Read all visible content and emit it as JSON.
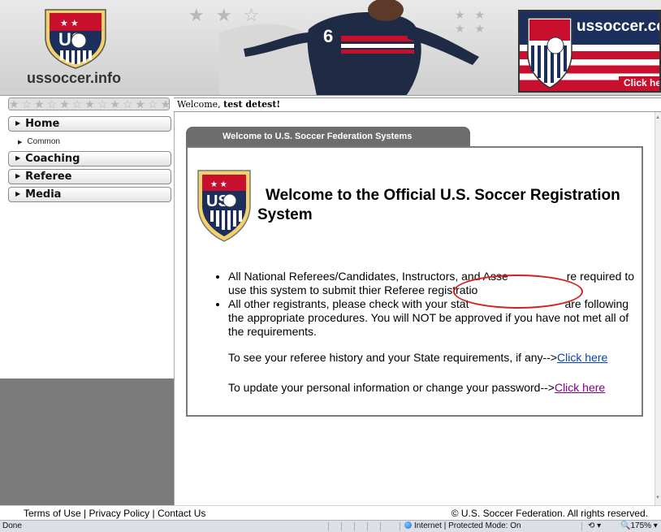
{
  "header": {
    "site_label": "ussoccer.info",
    "crest_text": "US",
    "player_number": "6",
    "ad_text": "ussoccer.co",
    "ad_click": "Click he"
  },
  "welcome": {
    "prefix": "Welcome,",
    "user": "test detest!"
  },
  "sidebar": {
    "items": [
      {
        "label": "Home"
      },
      {
        "label": "Coaching"
      },
      {
        "label": "Referee"
      },
      {
        "label": "Media"
      }
    ],
    "sub_items": [
      {
        "label": "Common"
      }
    ]
  },
  "main": {
    "tab_title": "Welcome to U.S. Soccer Federation Systems",
    "heading": "Welcome to the Official U.S. Soccer Registration System",
    "bullets": [
      {
        "before": "All National Referees/Candidates, Instructors, and Asse",
        "after_gap": "re required to use this system to submit thier Referee registratio"
      },
      {
        "before": "All other registrants, please check with your stat",
        "after_gap": "are following the appropriate procedures.  You will NOT be approved if you have not met all of the requirements."
      }
    ],
    "history_text": "To see your referee history and your State requirements, if any-->",
    "history_link": "Click here",
    "update_text": "To update your personal information or change your password-->",
    "update_link": "Click here"
  },
  "footer": {
    "terms": "Terms of Use",
    "privacy": "Privacy Policy",
    "contact": "Contact Us",
    "separator": "|",
    "copyright": "© U.S. Soccer Federation. All rights reserved."
  },
  "statusbar": {
    "status": "Done",
    "zone": "Internet | Protected Mode: On",
    "zoom": "175%"
  },
  "colors": {
    "navy": "#1c2f5c",
    "red": "#c8102e",
    "panel_gray": "#6d6d6d",
    "link": "#0645ad",
    "visited": "#800080"
  }
}
